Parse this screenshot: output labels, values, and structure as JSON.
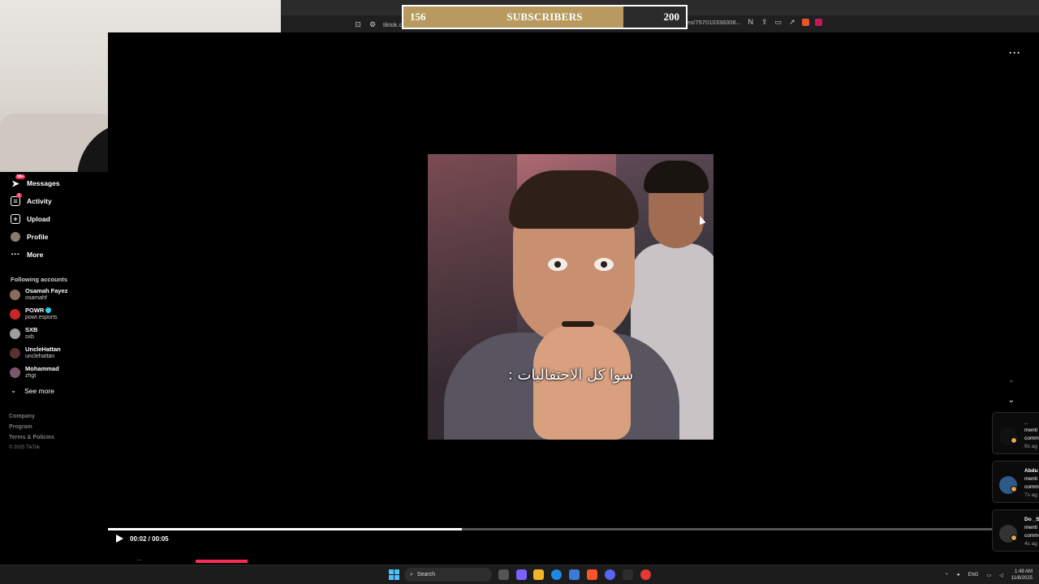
{
  "browser": {
    "url_left": "tiktok.c",
    "url_right": "N3onKa4zWOhgvob/video/757010338308...",
    "bookmark_icon": "bookmark-icon",
    "site_info_icon": "tune-icon"
  },
  "subscribers": {
    "current": "156",
    "label": "SUBSCRIBERS",
    "goal": "200",
    "progress_fraction": 0.78,
    "fill_color": "#b89a5e"
  },
  "sidebar": {
    "nav": [
      {
        "label": "Messages",
        "icon": "send-icon",
        "badge": "99+"
      },
      {
        "label": "Activity",
        "icon": "inbox-icon",
        "badge": "1"
      },
      {
        "label": "Upload",
        "icon": "plus-square-icon"
      },
      {
        "label": "Profile",
        "icon": "avatar"
      },
      {
        "label": "More",
        "icon": "more-dots-icon"
      }
    ],
    "following_title": "Following accounts",
    "accounts": [
      {
        "name": "Osamah Fayez",
        "handle": "osamahf",
        "color": "#8b6b5a"
      },
      {
        "name": "POWR",
        "handle": "powr.esports",
        "color": "#c62828",
        "verified": true
      },
      {
        "name": "SXB",
        "handle": "sxb",
        "color": "#9e9e9e"
      },
      {
        "name": "UncleHattan",
        "handle": "unclehattan",
        "color": "#5a3030"
      },
      {
        "name": "Mohammad",
        "handle": "zhgt",
        "color": "#7a5a6a"
      }
    ],
    "see_more": "See more",
    "footer": {
      "company": "Company",
      "program": "Program",
      "terms": "Terms & Policies",
      "copyright": "© 2025 TikTok"
    }
  },
  "video": {
    "caption": "سوا كل الاحتفاليات :",
    "time": "00:02 / 00:05",
    "progress_fraction": 0.4,
    "author_partial": "..."
  },
  "notifications": [
    {
      "name": "_",
      "line1": "menti",
      "line2": "comm",
      "time": "9s ag",
      "avatar_color": "#111"
    },
    {
      "name": "Abdu",
      "line1": "menti",
      "line2": "comm",
      "time": "7s ag",
      "avatar_color": "#2e5a8a"
    },
    {
      "name": "Do _S",
      "line1": "menti",
      "line2": "comm",
      "time": "4s ag",
      "avatar_color": "#333"
    }
  ],
  "taskbar": {
    "search_placeholder": "Search",
    "lang": "ENG",
    "time": "1:49 AM",
    "date": "11/8/2025"
  }
}
